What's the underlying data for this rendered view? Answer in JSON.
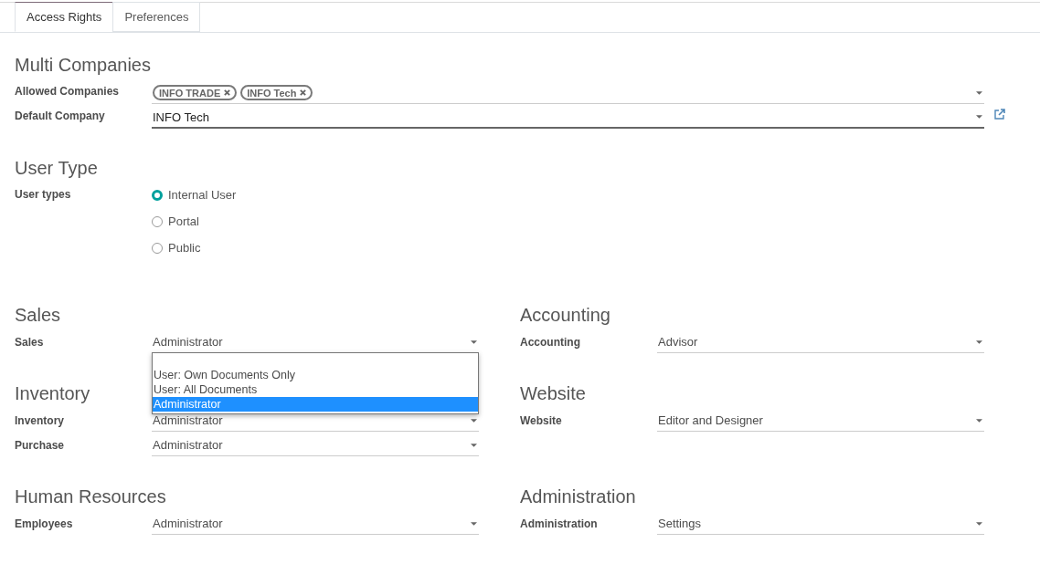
{
  "tabs": [
    {
      "label": "Access Rights",
      "selected": true
    },
    {
      "label": "Preferences",
      "selected": false
    }
  ],
  "multi_companies": {
    "title": "Multi Companies",
    "allowed_companies": {
      "label": "Allowed Companies",
      "tags": [
        "INFO TRADE",
        "INFO Tech"
      ]
    },
    "default_company": {
      "label": "Default Company",
      "value": "INFO Tech",
      "focused": true
    }
  },
  "user_type": {
    "title": "User Type",
    "label": "User types",
    "options": [
      {
        "label": "Internal User",
        "selected": true
      },
      {
        "label": "Portal",
        "selected": false
      },
      {
        "label": "Public",
        "selected": false
      }
    ]
  },
  "groups": [
    {
      "title": "Sales",
      "fields": [
        {
          "label": "Sales",
          "value": "Administrator",
          "options": [
            {
              "label": "User: Own Documents Only",
              "selected": false
            },
            {
              "label": "User: All Documents",
              "selected": false
            },
            {
              "label": "Administrator",
              "selected": true
            }
          ]
        }
      ]
    },
    {
      "title": "Accounting",
      "fields": [
        {
          "label": "Accounting",
          "value": "Advisor"
        }
      ]
    },
    {
      "title": "Inventory",
      "fields": [
        {
          "label": "Inventory",
          "value": "Administrator"
        },
        {
          "label": "Purchase",
          "value": "Administrator"
        }
      ]
    },
    {
      "title": "Website",
      "fields": [
        {
          "label": "Website",
          "value": "Editor and Designer"
        }
      ]
    },
    {
      "title": "Human Resources",
      "fields": [
        {
          "label": "Employees",
          "value": "Administrator"
        }
      ]
    },
    {
      "title": "Administration",
      "fields": [
        {
          "label": "Administration",
          "value": "Settings"
        }
      ]
    }
  ]
}
